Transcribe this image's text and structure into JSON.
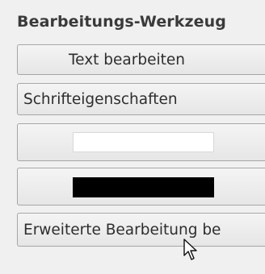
{
  "panel": {
    "title": "Bearbeitungs-Werkzeug"
  },
  "buttons": {
    "edit_text": "Text bearbeiten",
    "font_properties": "Schrifteigenschaften",
    "advanced_edit": "Erweiterte Bearbeitung be"
  },
  "colors": {
    "background_swatch": "#ffffff",
    "foreground_swatch": "#000000"
  },
  "icons": {
    "cursor": "mouse-pointer-icon"
  }
}
